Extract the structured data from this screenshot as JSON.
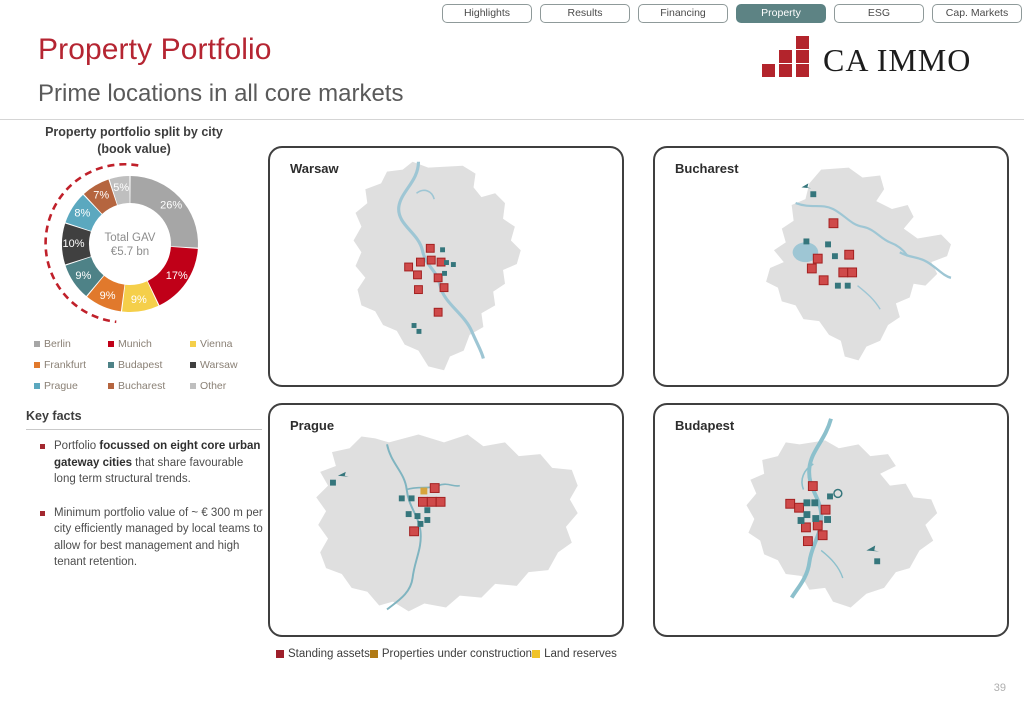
{
  "nav": {
    "tabs": [
      {
        "label": "Highlights",
        "active": false
      },
      {
        "label": "Results",
        "active": false
      },
      {
        "label": "Financing",
        "active": false
      },
      {
        "label": "Property",
        "active": true
      },
      {
        "label": "ESG",
        "active": false
      },
      {
        "label": "Cap. Markets",
        "active": false
      }
    ],
    "active_color": "#5d8384"
  },
  "header": {
    "title": "Property Portfolio",
    "subtitle": "Prime locations in all core markets",
    "title_color": "#b52532",
    "logo_text": "CA IMMO",
    "logo_color": "#b3242c"
  },
  "chart_panel": {
    "title_line1": "Property portfolio split by city",
    "title_line2": "(book value)",
    "center_line1": "Total GAV",
    "center_line2": "€5.7 bn"
  },
  "chart_data": {
    "type": "pie",
    "title": "Property portfolio split by city (book value)",
    "subtitle": "Total GAV €5.7 bn",
    "total_label": "Total GAV",
    "total_value": "€5.7 bn",
    "donut": true,
    "legend_position": "below",
    "categories": [
      "Berlin",
      "Munich",
      "Vienna",
      "Frankfurt",
      "Budapest",
      "Warsaw",
      "Prague",
      "Bucharest",
      "Other"
    ],
    "values": [
      26,
      17,
      9,
      9,
      9,
      10,
      8,
      7,
      5
    ],
    "value_labels": [
      "26%",
      "17%",
      "9%",
      "9%",
      "9%",
      "10%",
      "8%",
      "7%",
      "5%"
    ],
    "colors": [
      "#a6a6a6",
      "#c00018",
      "#f5cf4a",
      "#e1792c",
      "#4e8287",
      "#404040",
      "#5ba8bf",
      "#b5653f",
      "#bfbfbf"
    ],
    "annotation": "dashed red arc highlighting the eight core gateway cities"
  },
  "city_legend": [
    {
      "label": "Berlin",
      "color": "#a6a6a6"
    },
    {
      "label": "Munich",
      "color": "#c00018"
    },
    {
      "label": "Vienna",
      "color": "#f5cf4a"
    },
    {
      "label": "Frankfurt",
      "color": "#e1792c"
    },
    {
      "label": "Budapest",
      "color": "#4e8287"
    },
    {
      "label": "Warsaw",
      "color": "#404040"
    },
    {
      "label": "Prague",
      "color": "#5ba8bf"
    },
    {
      "label": "Bucharest",
      "color": "#b5653f"
    },
    {
      "label": "Other",
      "color": "#bfbfbf"
    }
  ],
  "key_facts": {
    "heading": "Key facts",
    "items": [
      {
        "pre": "Portfolio ",
        "bold": "focussed on eight core urban gateway cities",
        "post": " that share favourable long term structural trends."
      },
      {
        "pre": "Minimum portfolio value of ~ € 300 m per city efficiently managed by local teams to allow for best management and high tenant retention.",
        "bold": "",
        "post": ""
      }
    ]
  },
  "maps": [
    {
      "id": "warsaw",
      "title": "Warsaw"
    },
    {
      "id": "bucharest",
      "title": "Bucharest"
    },
    {
      "id": "prague",
      "title": "Prague"
    },
    {
      "id": "budapest",
      "title": "Budapest"
    }
  ],
  "asset_legend": [
    {
      "label": "Standing assets",
      "color": "#9e1f2a"
    },
    {
      "label": "Properties under construction",
      "color": "#b07a16"
    },
    {
      "label": "Land reserves",
      "color": "#f0c329"
    }
  ],
  "footer": {
    "page_number": "39"
  }
}
